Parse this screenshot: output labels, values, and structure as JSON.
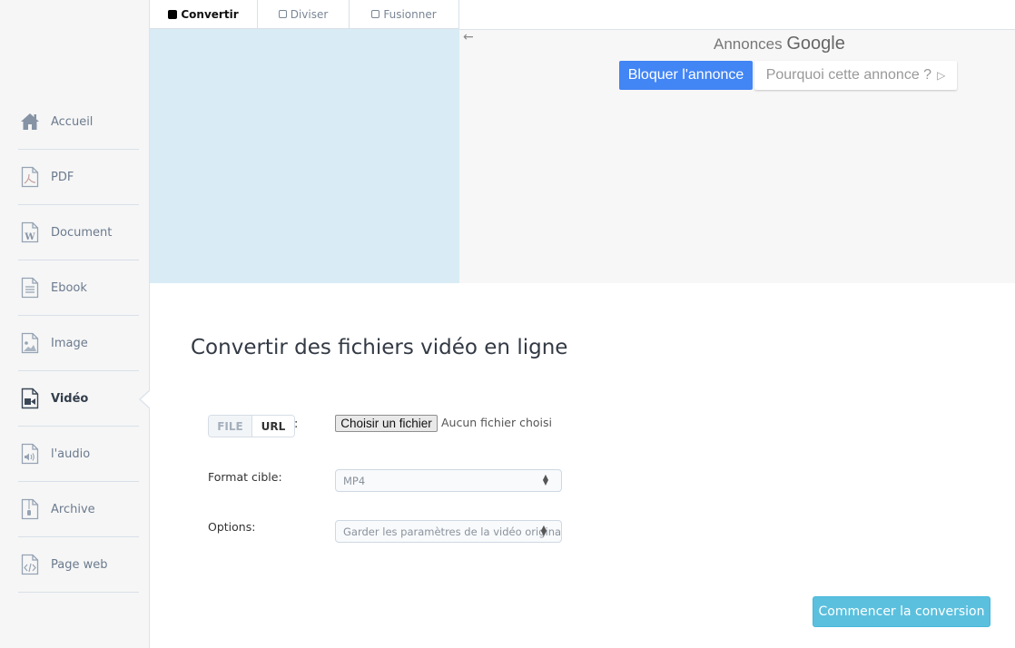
{
  "sidebar": {
    "items": [
      {
        "label": "Accueil",
        "icon": "home-icon",
        "active": false
      },
      {
        "label": "PDF",
        "icon": "pdf-file-icon",
        "active": false
      },
      {
        "label": "Document",
        "icon": "word-file-icon",
        "active": false
      },
      {
        "label": "Ebook",
        "icon": "ebook-file-icon",
        "active": false
      },
      {
        "label": "Image",
        "icon": "image-file-icon",
        "active": false
      },
      {
        "label": "Vidéo",
        "icon": "video-file-icon",
        "active": true
      },
      {
        "label": "l'audio",
        "icon": "audio-file-icon",
        "active": false
      },
      {
        "label": "Archive",
        "icon": "archive-file-icon",
        "active": false
      },
      {
        "label": "Page web",
        "icon": "code-file-icon",
        "active": false
      }
    ]
  },
  "tabs": [
    {
      "label": "Convertir",
      "checked": true
    },
    {
      "label": "Diviser",
      "checked": false
    },
    {
      "label": "Fusionner",
      "checked": false
    }
  ],
  "ad": {
    "heading_prefix": "Annonces",
    "heading_brand": "Google",
    "block_label": "Bloquer l'annonce",
    "why_label": "Pourquoi cette annonce ?",
    "back_glyph": "←",
    "why_glyph": "▷"
  },
  "main": {
    "title": "Convertir des fichiers vidéo en ligne",
    "source_toggle": {
      "file": "FILE",
      "url": "URL",
      "separator": ":"
    },
    "file_button": "Choisir un fichier",
    "file_status": "Aucun fichier choisi",
    "format_label": "Format cible:",
    "format_value": "MP4",
    "options_label": "Options:",
    "options_value": "Garder les paramètres de la vidéo originale",
    "start_button": "Commencer la conversion"
  },
  "colors": {
    "accent_ad_button": "#4285f4",
    "start_button": "#5bc0de",
    "ad_left_bg": "#d9ecf5"
  }
}
